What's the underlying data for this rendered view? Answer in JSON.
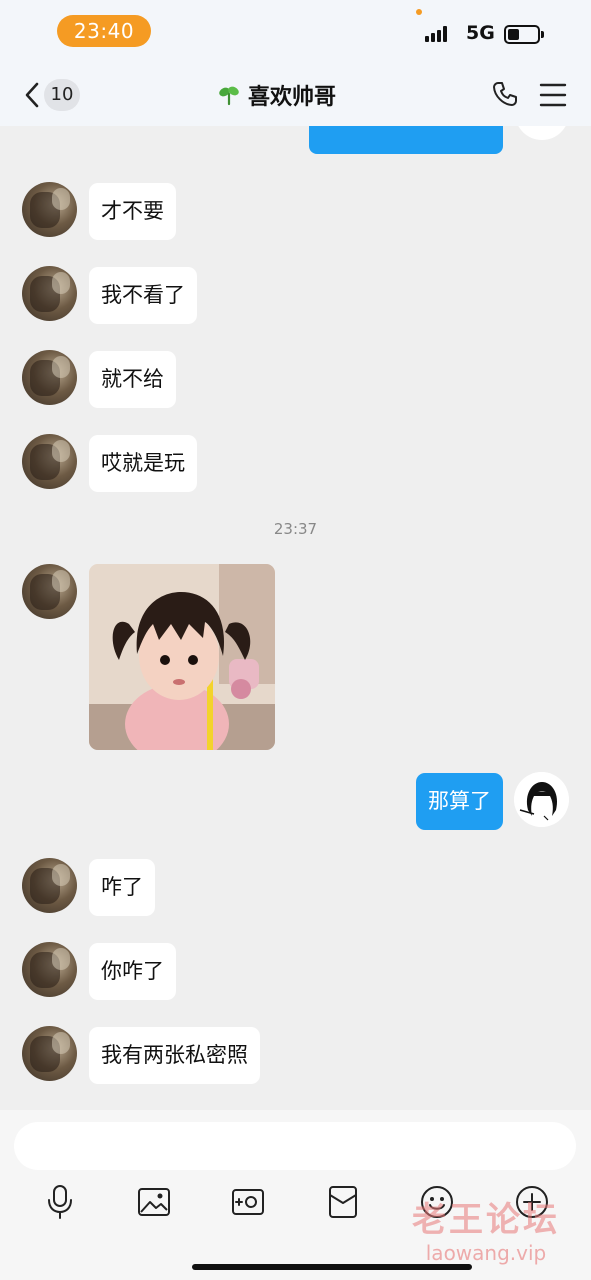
{
  "status_bar": {
    "time": "23:40",
    "network": "5G"
  },
  "nav": {
    "unread_count": "10",
    "title": "喜欢帅哥",
    "icons": [
      "back-chevron-icon",
      "sprout-icon",
      "phone-icon",
      "menu-icon"
    ]
  },
  "messages": [
    {
      "from": "other",
      "text": "才不要"
    },
    {
      "from": "other",
      "text": "我不看了"
    },
    {
      "from": "other",
      "text": "就不给"
    },
    {
      "from": "other",
      "text": "哎就是玩"
    },
    {
      "timestamp": "23:37"
    },
    {
      "from": "other",
      "type": "sticker"
    },
    {
      "from": "self",
      "text": "那算了"
    },
    {
      "from": "other",
      "text": "咋了"
    },
    {
      "from": "other",
      "text": "你咋了"
    },
    {
      "from": "other",
      "text": "我有两张私密照"
    }
  ],
  "toolbar": {
    "icons": [
      "microphone-icon",
      "image-icon",
      "camera-icon",
      "red-packet-icon",
      "emoji-icon",
      "plus-icon"
    ]
  },
  "watermark": {
    "title": "老王论坛",
    "url": "laowang.vip"
  },
  "colors": {
    "accent_blue": "#1f9ef2",
    "time_pill_orange": "#f59b23",
    "background": "#efefef"
  }
}
